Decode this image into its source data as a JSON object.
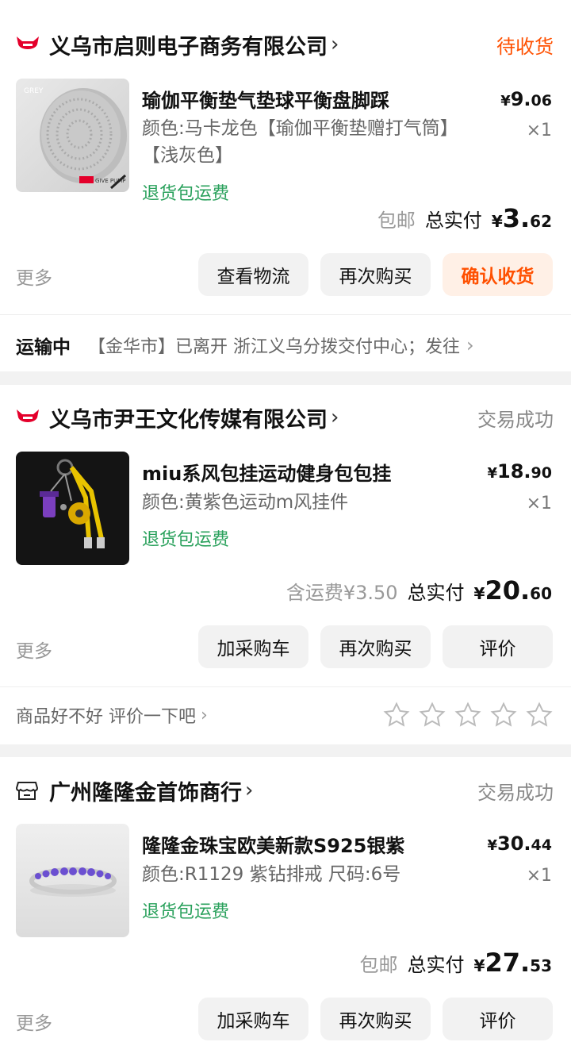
{
  "orders": [
    {
      "shop_name": "义乌市启则电子商务有限公司",
      "status": "待收货",
      "item": {
        "title": "瑜伽平衡垫气垫球平衡盘脚踩",
        "sku": "颜色:马卡龙色【瑜伽平衡垫赠打气筒】【浅灰色】",
        "return_note": "退货包运费",
        "price_yen": "¥",
        "price_int": "9.",
        "price_dec": "06",
        "qty": "×1",
        "image_label": "GREY",
        "image_tag": "GIVE PUMP"
      },
      "ship_note": "包邮",
      "total_label": "总实付",
      "total_yen": "¥",
      "total_int": "3.",
      "total_dec": "62",
      "more": "更多",
      "buttons": [
        "查看物流",
        "再次购买",
        "确认收货"
      ],
      "logistics": {
        "status": "运输中",
        "text": "【金华市】已离开 浙江义乌分拨交付中心；发往"
      }
    },
    {
      "shop_name": "义乌市尹王文化传媒有限公司",
      "status": "交易成功",
      "item": {
        "title": "miu系风包挂运动健身包包挂",
        "sku": "颜色:黄紫色运动m风挂件",
        "return_note": "退货包运费",
        "price_yen": "¥",
        "price_int": "18.",
        "price_dec": "90",
        "qty": "×1"
      },
      "ship_note": "含运费¥3.50",
      "total_label": "总实付",
      "total_yen": "¥",
      "total_int": "20.",
      "total_dec": "60",
      "more": "更多",
      "buttons": [
        "加采购车",
        "再次购买",
        "评价"
      ],
      "review_prompt": "商品好不好 评价一下吧"
    },
    {
      "shop_name": "广州隆隆金首饰商行",
      "status": "交易成功",
      "item": {
        "title": "隆隆金珠宝欧美新款S925银紫",
        "sku": "颜色:R1129 紫钻排戒 尺码:6号",
        "return_note": "退货包运费",
        "price_yen": "¥",
        "price_int": "30.",
        "price_dec": "44",
        "qty": "×1"
      },
      "ship_note": "包邮",
      "total_label": "总实付",
      "total_yen": "¥",
      "total_int": "27.",
      "total_dec": "53",
      "more": "更多",
      "buttons": [
        "加采购车",
        "再次购买",
        "评价"
      ]
    }
  ],
  "colors": {
    "accent": "#ff5000",
    "green": "#2aa15c",
    "tmall_red": "#e4002b"
  }
}
